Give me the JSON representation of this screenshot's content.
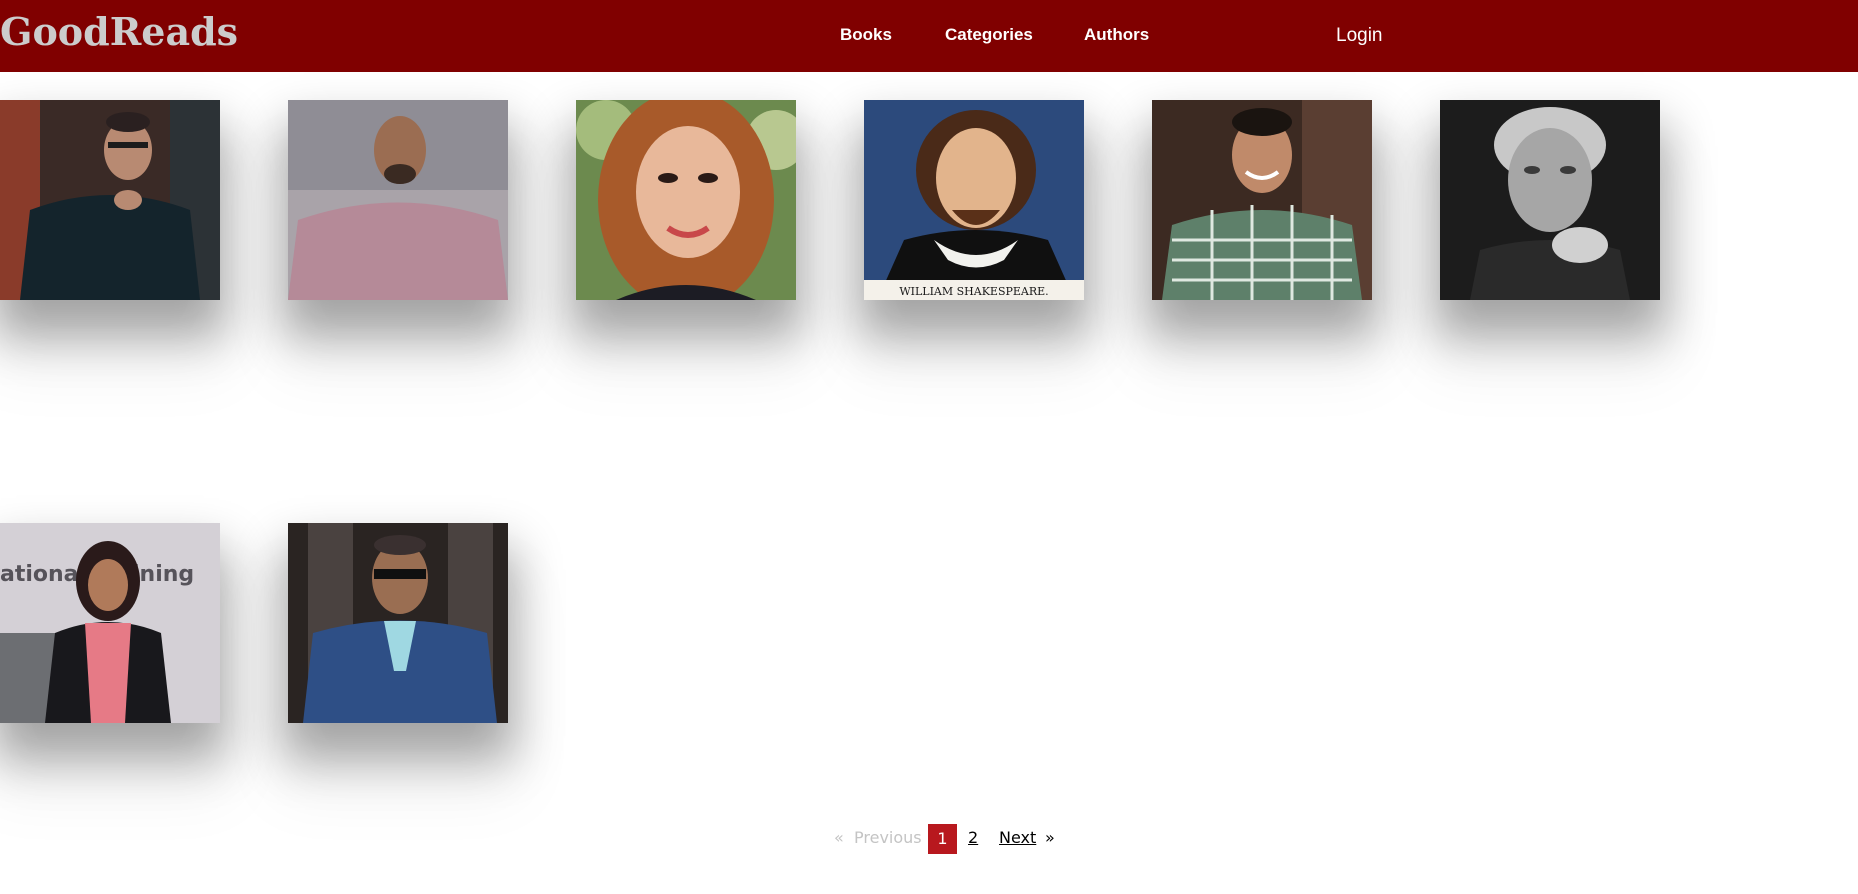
{
  "brand": "GoodReads",
  "nav": {
    "books": "Books",
    "categories": "Categories",
    "authors": "Authors",
    "login": "Login"
  },
  "authors": [
    {
      "portrait": "man-glasses-dark-sweater"
    },
    {
      "portrait": "man-bald-checked-shirt"
    },
    {
      "portrait": "woman-auburn-hair-smiling"
    },
    {
      "portrait": "shakespeare-engraving",
      "caption": "WILLIAM  SHAKESPEARE."
    },
    {
      "portrait": "young-man-gingham-shirt"
    },
    {
      "portrait": "elderly-woman-bw"
    },
    {
      "portrait": "woman-pink-scarf",
      "backdrop_text": "ational Training"
    },
    {
      "portrait": "elderly-man-blue-suit"
    }
  ],
  "pagination": {
    "prev_arrow": "«",
    "previous": "Previous",
    "pages": [
      "1",
      "2"
    ],
    "current": "1",
    "next": "Next",
    "next_arrow": "»"
  },
  "colors": {
    "navbar": "#800000",
    "brand_text": "#cccccc",
    "active_page": "#b8181e"
  }
}
